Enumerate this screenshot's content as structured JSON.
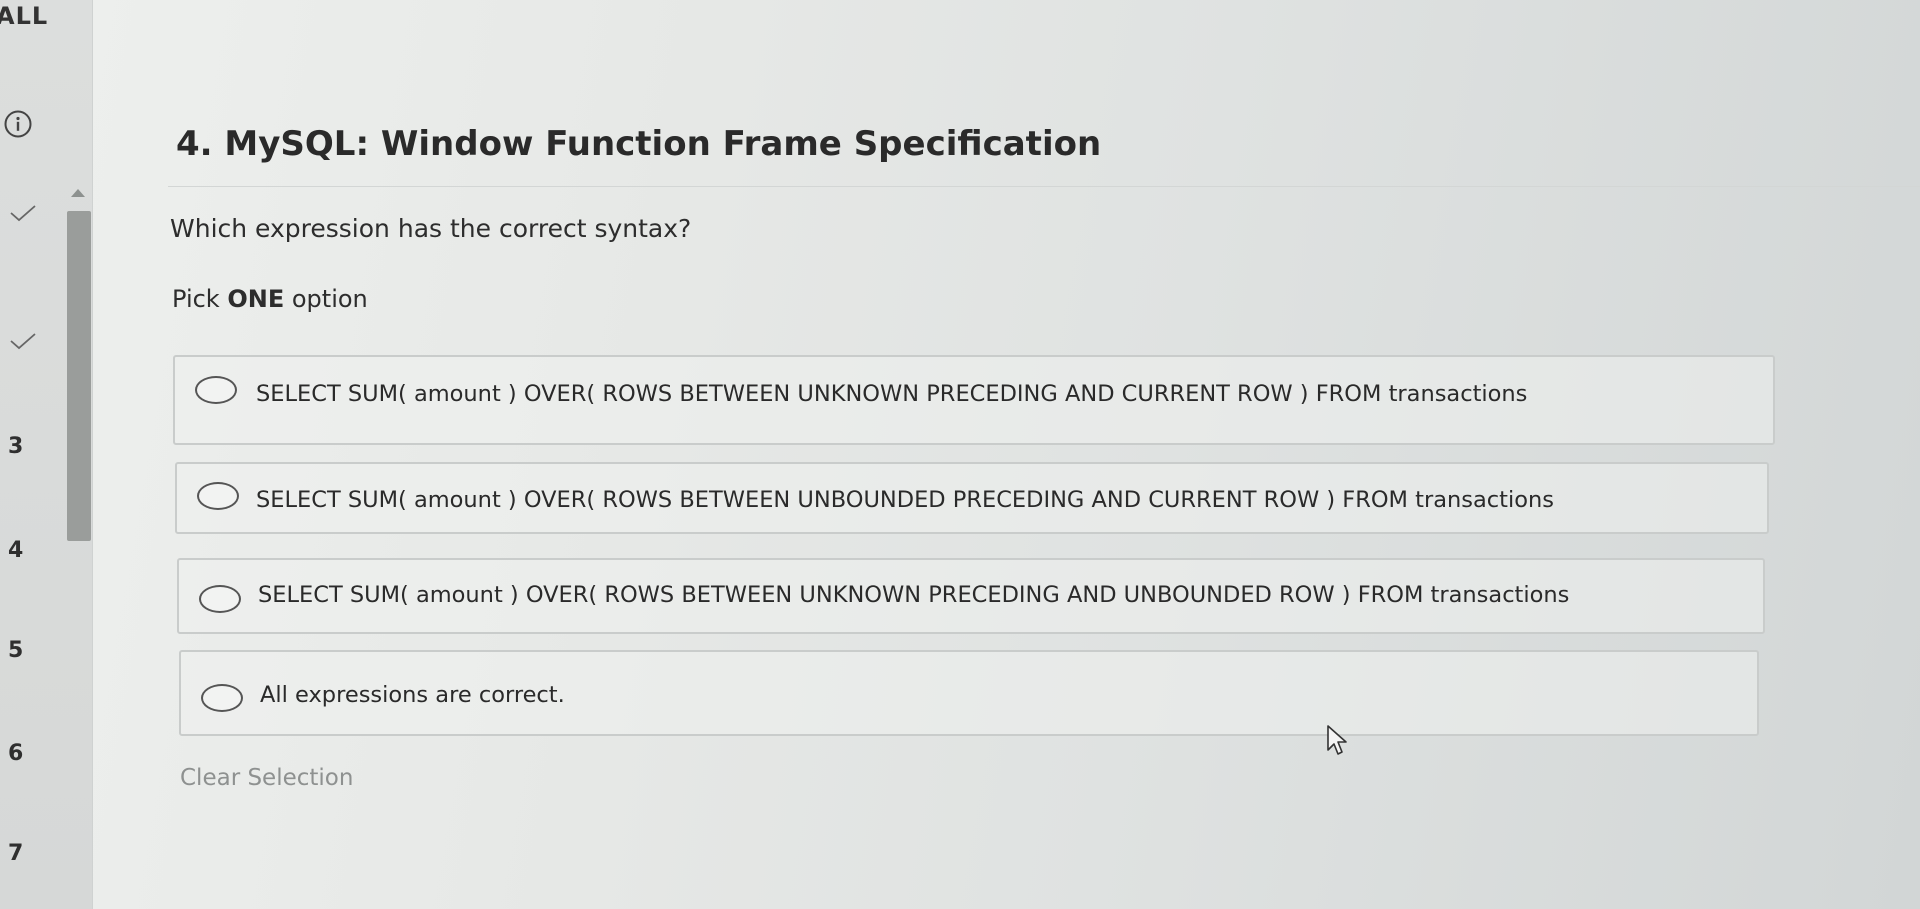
{
  "sidebar": {
    "filter_label": "ALL",
    "items": [
      {
        "label": "3"
      },
      {
        "label": "4"
      },
      {
        "label": "5"
      },
      {
        "label": "6"
      },
      {
        "label": "7"
      }
    ]
  },
  "question": {
    "title": "4. MySQL: Window Function Frame Specification",
    "prompt": "Which expression has the correct syntax?",
    "instruction_prefix": "Pick ",
    "instruction_emphasis": "ONE",
    "instruction_suffix": " option",
    "options": [
      {
        "label": "SELECT SUM( amount ) OVER( ROWS BETWEEN UNKNOWN PRECEDING AND CURRENT ROW ) FROM transactions",
        "selected": false
      },
      {
        "label": "SELECT SUM( amount ) OVER( ROWS BETWEEN UNBOUNDED PRECEDING AND CURRENT ROW ) FROM transactions",
        "selected": false
      },
      {
        "label": "SELECT SUM( amount ) OVER( ROWS BETWEEN UNKNOWN PRECEDING AND UNBOUNDED ROW ) FROM transactions",
        "selected": false
      },
      {
        "label": "All expressions are correct.",
        "selected": false
      }
    ],
    "clear_label": "Clear Selection"
  },
  "icons": {
    "info": "info-icon",
    "answered": "checkmark-icon",
    "scroll": "scroll-up-arrow-icon",
    "pointer": "mouse-pointer-icon"
  }
}
